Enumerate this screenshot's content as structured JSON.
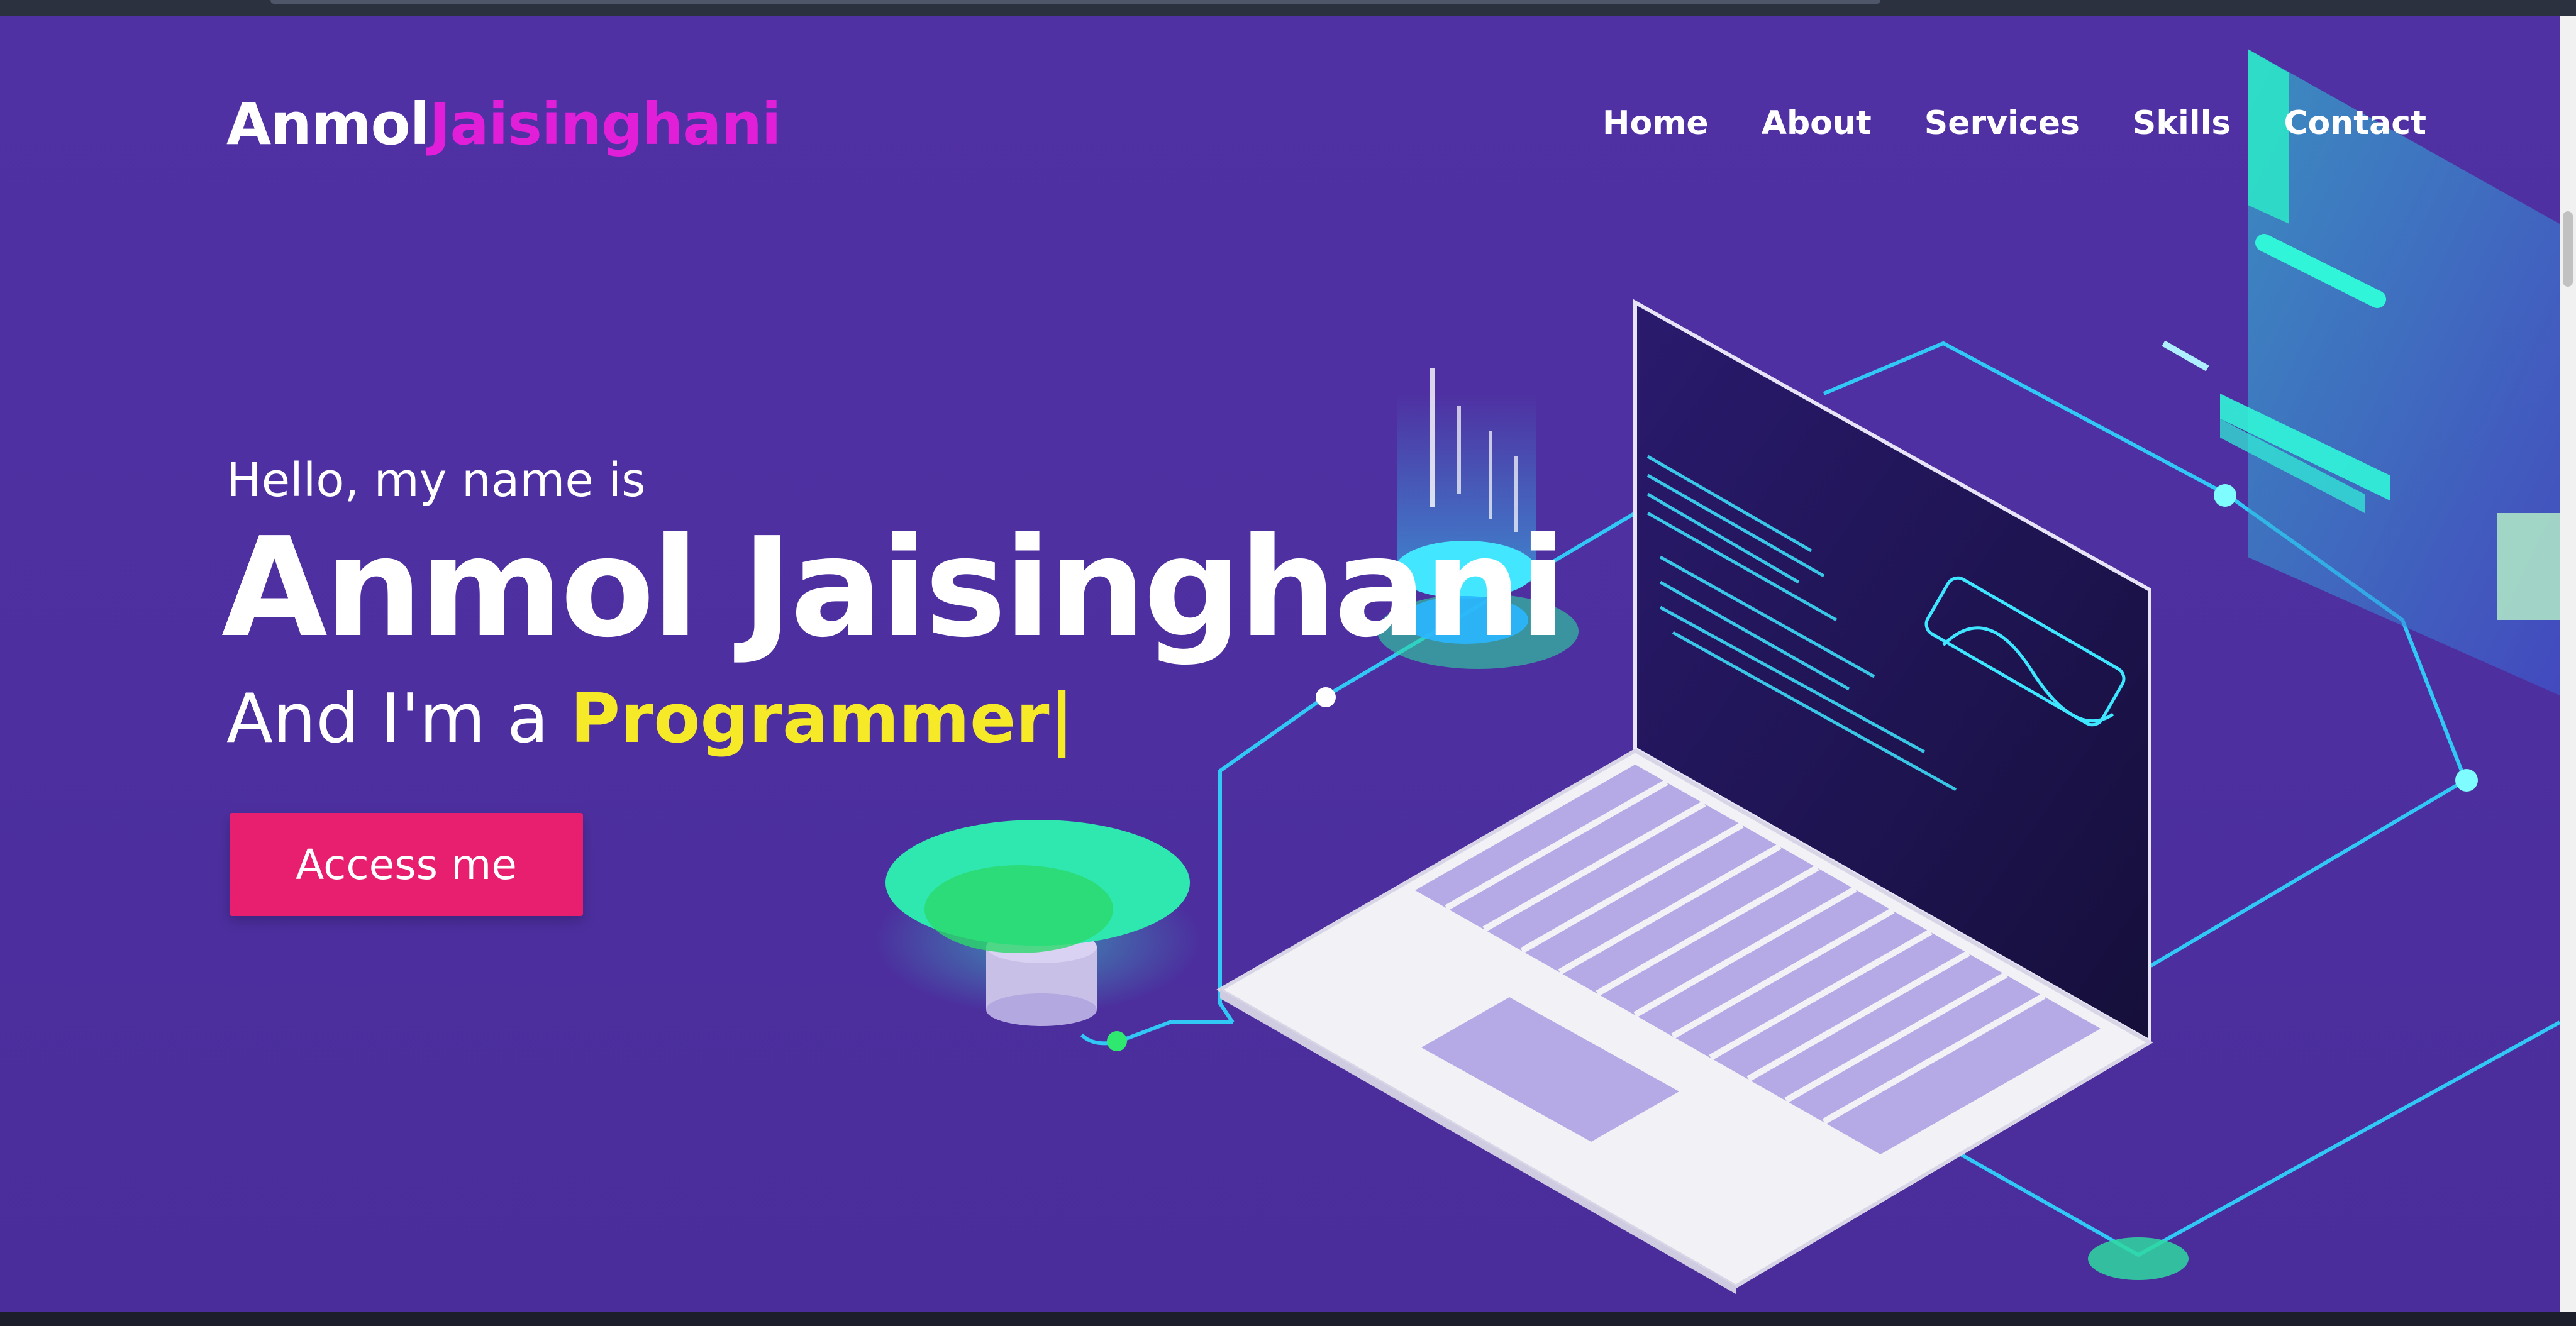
{
  "logo": {
    "first": "Anmol",
    "last": "Jaisinghani"
  },
  "nav": {
    "items": [
      {
        "label": "Home"
      },
      {
        "label": "About"
      },
      {
        "label": "Services"
      },
      {
        "label": "Skills"
      },
      {
        "label": "Contact"
      }
    ]
  },
  "hero": {
    "greeting": "Hello, my name is",
    "name": "Anmol Jaisinghani",
    "role_prefix": "And I'm a ",
    "role_highlight": "Programmer|",
    "cta_label": "Access me"
  },
  "colors": {
    "background": "#4e30a2",
    "logo_accent": "#e11fd8",
    "role_highlight": "#f5e928",
    "cta": "#e81f6e",
    "glow": "#2ee8ff"
  },
  "icons": [
    "laptop-illustration",
    "monitor-illustration",
    "green-disc-illustration",
    "hologram-illustration"
  ]
}
